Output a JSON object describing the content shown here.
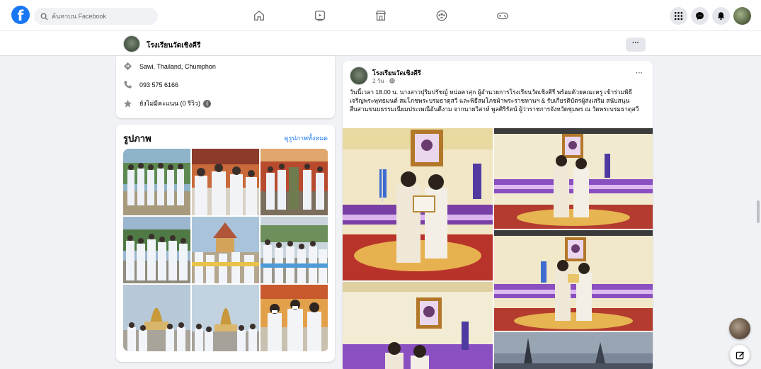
{
  "topbar": {
    "search_placeholder": "ค้นหาบน Facebook",
    "nav_icons": [
      "home-icon",
      "watch-icon",
      "marketplace-icon",
      "groups-icon",
      "gaming-icon"
    ],
    "right_icons": [
      "menu-grid-icon",
      "messenger-icon",
      "notifications-icon"
    ]
  },
  "page": {
    "name": "โรงเรียนวัดเชิงคีรี",
    "more_label": "···"
  },
  "intro": {
    "address": "Sawi, Thailand, Chumphon",
    "phone": "093 575 6166",
    "rating": "ยังไม่มีคะแนน (0 รีวิว)",
    "info_icon": "i"
  },
  "photos": {
    "title": "รูปภาพ",
    "see_all": "ดูรูปภาพทั้งหมด"
  },
  "post": {
    "author": "โรงเรียนวัดเชิงคีรี",
    "time": "2 วัน · ",
    "more_label": "···",
    "text": "วันนี้เวลา 18.00 น. นางสาวปุริมปรัชญ์ หน่อคาสุก ผู้อำนวยการโรงเรียนวัดเชิงคีรี พร้อมด้วยคณะครู เข้าร่วมพิธีเจริญพระพุทธมนต์ สมโภชพระบรมธาตุสวี และพิธีสมโภชผ้าพระราชทานฯ & รับเกียรติบัตรผู้ส่งเสริม สนับสนุนสืบสานขนบธรรมเนียมประเพณีอันดีงาม จากนายวิสาห์ พูลศิริรัตน์ ผู้ว่าราชการจังหวัดชุมพร ณ วัดพระบรมธาตุสวี"
  }
}
